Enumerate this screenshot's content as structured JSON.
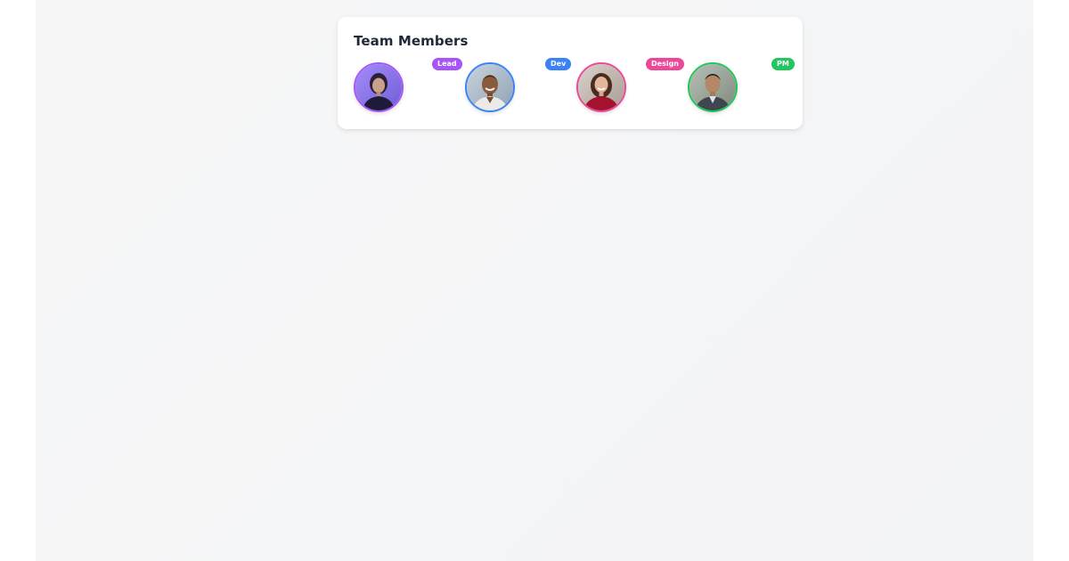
{
  "card": {
    "title": "Team Members"
  },
  "members": [
    {
      "role": "Lead",
      "accent": "#a855f7",
      "photo_icon": "portrait-woman-dark-hair"
    },
    {
      "role": "Dev",
      "accent": "#3b82f6",
      "photo_icon": "portrait-man-smiling"
    },
    {
      "role": "Design",
      "accent": "#ec4899",
      "photo_icon": "portrait-woman-red-sweater"
    },
    {
      "role": "PM",
      "accent": "#22c55e",
      "photo_icon": "portrait-man-suit"
    }
  ]
}
